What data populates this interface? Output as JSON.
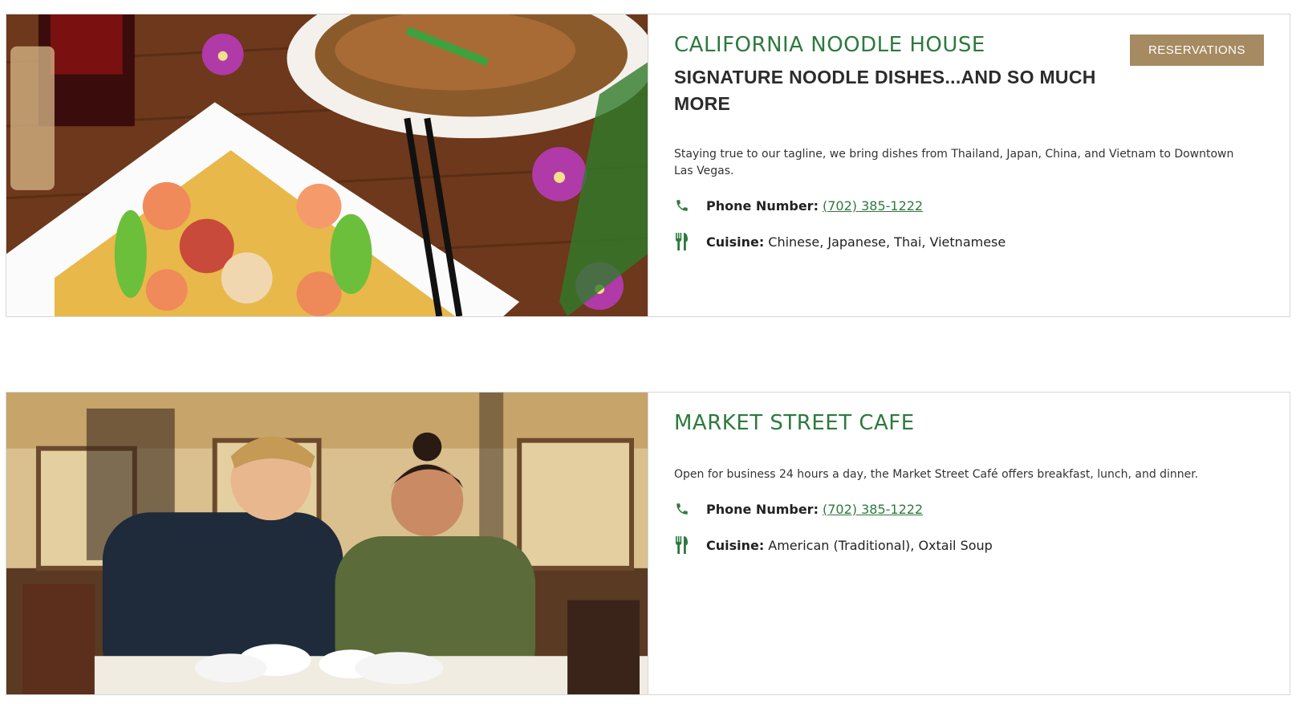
{
  "colors": {
    "brand_green": "#2d7a3e",
    "button_bg": "#a58a62",
    "border": "#d6d6d6"
  },
  "restaurants": [
    {
      "name": "CALIFORNIA NOODLE HOUSE",
      "tagline": "SIGNATURE NOODLE DISHES...AND SO MUCH MORE",
      "reservations_label": "RESERVATIONS",
      "description": "Staying true to our tagline, we bring dishes from Thailand, Japan, China, and Vietnam to Downtown Las Vegas.",
      "phone_label": "Phone Number:",
      "phone": "(702) 385-1222",
      "cuisine_label": "Cuisine:",
      "cuisine": "Chinese, Japanese, Thai, Vietnamese",
      "photo_icon": "noodle-dish-photo"
    },
    {
      "name": "MARKET STREET CAFE",
      "description": "Open for business 24 hours a day, the Market Street Café offers breakfast, lunch, and dinner.",
      "phone_label": "Phone Number:",
      "phone": "(702) 385-1222",
      "cuisine_label": "Cuisine:",
      "cuisine": "American (Traditional), Oxtail Soup",
      "photo_icon": "diners-photo"
    }
  ],
  "icons": {
    "phone": "phone-icon",
    "cuisine": "fork-knife-icon"
  }
}
